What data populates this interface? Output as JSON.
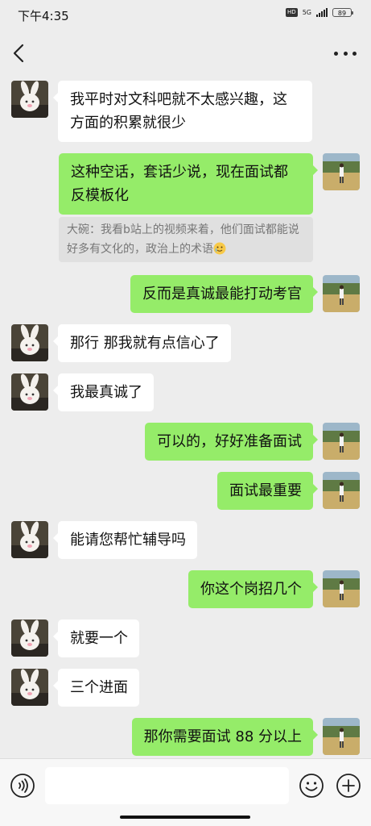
{
  "status_bar": {
    "time": "下午4:35",
    "hd": "HD",
    "network": "5G",
    "battery": "89"
  },
  "nav": {
    "back_icon": "chevron-left-icon",
    "more_icon": "more-dots-icon"
  },
  "messages": [
    {
      "side": "in",
      "text": "我平时对文科吧就不太感兴趣，这方面的积累就很少"
    },
    {
      "side": "out",
      "text": "这种空话，套话少说，现在面试都反模板化"
    },
    {
      "side": "quote",
      "text": "大碗：我看b站上的视频来着，他们面试都能说好多有文化的，政治上的术语"
    },
    {
      "side": "out",
      "text": "反而是真诚最能打动考官"
    },
    {
      "side": "in",
      "text": "那行 那我就有点信心了"
    },
    {
      "side": "in",
      "text": "我最真诚了"
    },
    {
      "side": "out",
      "text": "可以的，好好准备面试"
    },
    {
      "side": "out",
      "text": "面试最重要"
    },
    {
      "side": "in",
      "text": "能请您帮忙辅导吗"
    },
    {
      "side": "out",
      "text": "你这个岗招几个"
    },
    {
      "side": "in",
      "text": "就要一个"
    },
    {
      "side": "in",
      "text": "三个进面"
    },
    {
      "side": "out",
      "text": "那你需要面试 88 分以上"
    }
  ],
  "input_bar": {
    "placeholder": "",
    "voice_icon": "voice-icon",
    "emoji_icon": "emoji-icon",
    "plus_icon": "plus-icon"
  },
  "colors": {
    "background": "#ededed",
    "outgoing_bubble": "#95ec69",
    "incoming_bubble": "#ffffff",
    "quote_background": "#e0e0e0"
  }
}
